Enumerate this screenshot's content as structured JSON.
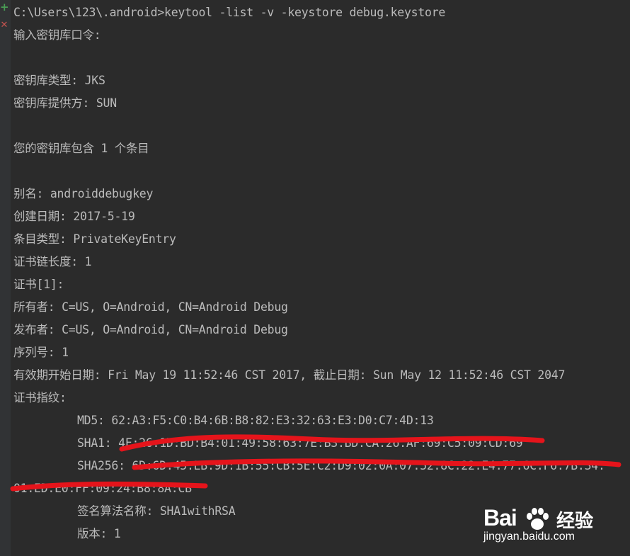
{
  "toolbar": {
    "rerun_icon": "plus-icon",
    "stop_icon": "cross-icon",
    "rerun_glyph": "+",
    "stop_glyph": "✕"
  },
  "console": {
    "lines": [
      "C:\\Users\\123\\.android>keytool -list -v -keystore debug.keystore",
      "输入密钥库口令:",
      "",
      "密钥库类型: JKS",
      "密钥库提供方: SUN",
      "",
      "您的密钥库包含 1 个条目",
      "",
      "别名: androiddebugkey",
      "创建日期: 2017-5-19",
      "条目类型: PrivateKeyEntry",
      "证书链长度: 1",
      "证书[1]:",
      "所有者: C=US, O=Android, CN=Android Debug",
      "发布者: C=US, O=Android, CN=Android Debug",
      "序列号: 1",
      "有效期开始日期: Fri May 19 11:52:46 CST 2017, 截止日期: Sun May 12 11:52:46 CST 2047",
      "证书指纹:",
      "MD5: 62:A3:F5:C0:B4:6B:B8:82:E3:32:63:E3:D0:C7:4D:13",
      "SHA1: 4F:26:1D:BD:B4:01:49:58:63:7E:B3:BD:CA:26:AF:69:C5:09:CD:69",
      "SHA256: 6D:6D:45:EB:9D:1B:55:CB:5E:C2:D9:02:0A:07:52:8C:22:E4:77:6C:F6:7B:34:",
      "01:ED:E0:FF:09:24:B8:8A:CB",
      "签名算法名称: SHA1withRSA",
      "版本: 1"
    ]
  },
  "colors": {
    "background": "#2b2b2b",
    "text": "#bbbbbb",
    "redaction": "#e5141b"
  },
  "watermark": {
    "brand_left": "Bai",
    "brand_right": "经验",
    "url": "jingyan.baidu.com"
  }
}
